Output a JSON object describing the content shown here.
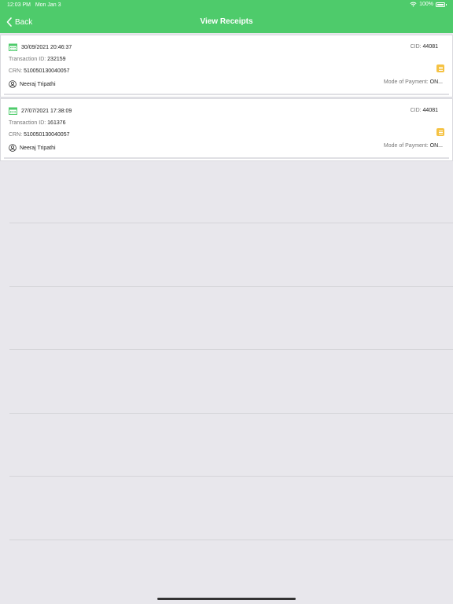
{
  "status_bar": {
    "time": "12:03 PM",
    "date": "Mon Jan 3",
    "battery": "100%"
  },
  "nav": {
    "back_label": "Back",
    "title": "View Receipts"
  },
  "labels": {
    "transaction_id": "Transaction ID:",
    "crn": "CRN:",
    "cid": "CID:",
    "mode_of_payment": "Mode of Payment:"
  },
  "receipts": [
    {
      "datetime": "30/09/2021 20:46:37",
      "cid": "44081",
      "transaction_id": "232159",
      "crn": "510050130040057",
      "name": "Neeraj Tripathi",
      "mode_of_payment": "ON..."
    },
    {
      "datetime": "27/07/2021 17:38:09",
      "cid": "44081",
      "transaction_id": "161376",
      "crn": "510050130040057",
      "name": "Neeraj Tripathi",
      "mode_of_payment": "ON..."
    }
  ],
  "colors": {
    "accent": "#4ecb6b",
    "badge": "#f5c242",
    "background": "#e8e7ec"
  },
  "icons": {
    "back": "chevron-left-icon",
    "wifi": "wifi-icon",
    "battery": "battery-icon",
    "calendar": "calendar-icon",
    "user": "user-circle-icon",
    "badge": "menu-badge-icon"
  }
}
